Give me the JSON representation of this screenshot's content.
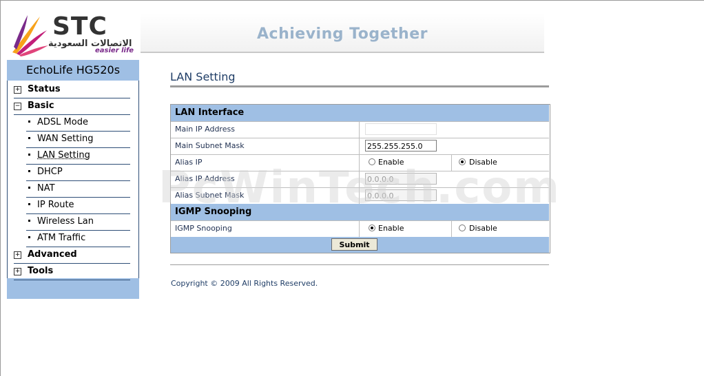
{
  "logo": {
    "brand": "STC",
    "arabic": "الاتصالات السعودية",
    "tagline": "easier life"
  },
  "banner": {
    "text": "Achieving Together"
  },
  "sidebar": {
    "title": "EchoLife HG520s",
    "items": [
      {
        "label": "Status",
        "toggle": "+"
      },
      {
        "label": "Basic",
        "toggle": "−"
      },
      {
        "label": "ADSL Mode"
      },
      {
        "label": "WAN Setting"
      },
      {
        "label": "LAN Setting"
      },
      {
        "label": "DHCP"
      },
      {
        "label": "NAT"
      },
      {
        "label": "IP Route"
      },
      {
        "label": "Wireless Lan"
      },
      {
        "label": "ATM Traffic"
      },
      {
        "label": "Advanced",
        "toggle": "+"
      },
      {
        "label": "Tools",
        "toggle": "+"
      }
    ]
  },
  "page": {
    "title": "LAN Setting"
  },
  "lan": {
    "section_title": "LAN Interface",
    "main_ip_label": "Main IP Address",
    "main_ip_value": "",
    "subnet_label": "Main Subnet Mask",
    "subnet_value": "255.255.255.0",
    "alias_ip_label": "Alias IP",
    "enable_label": "Enable",
    "disable_label": "Disable",
    "alias_ip_address_label": "Alias IP Address",
    "alias_ip_address_value": "0.0.0.0",
    "alias_subnet_label": "Alias Subnet Mask",
    "alias_subnet_value": "0.0.0.0"
  },
  "igmp": {
    "section_title": "IGMP Snooping",
    "label": "IGMP Snooping",
    "enable_label": "Enable",
    "disable_label": "Disable"
  },
  "submit_label": "Submit",
  "footer": {
    "copyright": "Copyright © 2009 All Rights Reserved."
  },
  "watermark": "PcWinTech.com",
  "colors": {
    "accent": "#9fbfe4",
    "title": "#1f3d66",
    "banner_text": "#9ab3cb"
  }
}
